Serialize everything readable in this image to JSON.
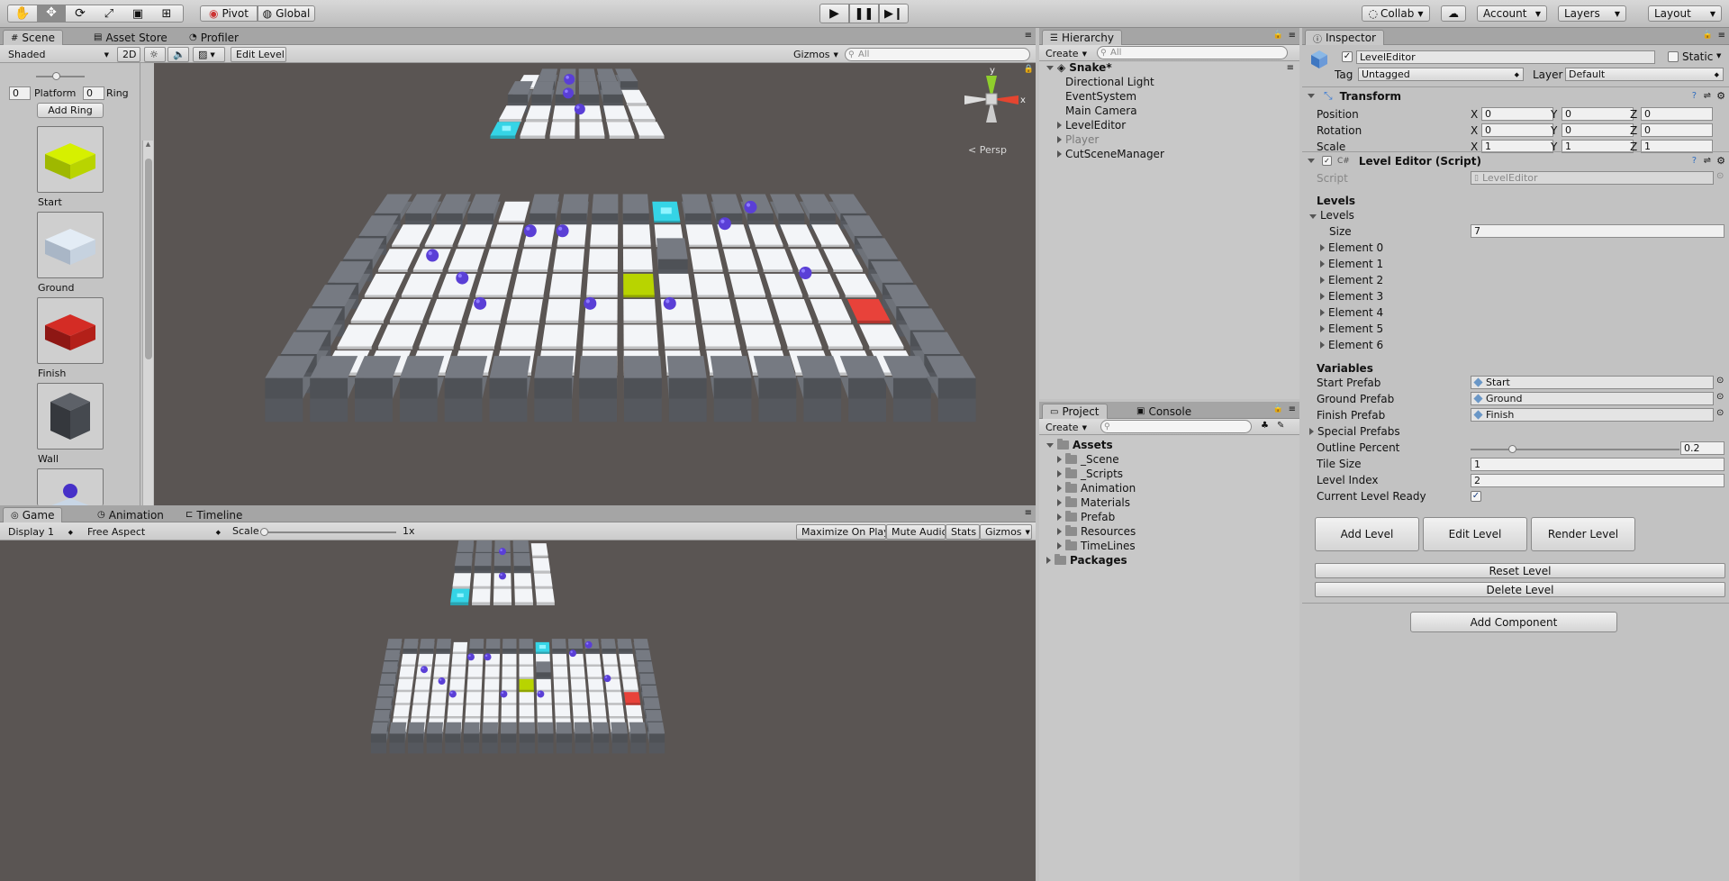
{
  "top_toolbar": {
    "pivot": "Pivot",
    "global": "Global",
    "collab": "Collab",
    "account": "Account",
    "layers": "Layers",
    "layout": "Layout"
  },
  "scene": {
    "tabs": [
      "Scene",
      "Asset Store",
      "Profiler"
    ],
    "shading": "Shaded",
    "mode_2d": "2D",
    "edit_level": "Edit Level",
    "gizmos": "Gizmos",
    "search_placeholder": "All",
    "persp": "Persp",
    "gizmo_y": "y",
    "gizmo_x": "x"
  },
  "level_palette": {
    "platform_value": "0",
    "platform_label": "Platform",
    "ring_value": "0",
    "ring_label": "Ring",
    "add_ring": "Add Ring",
    "items": [
      "Start",
      "Ground",
      "Finish",
      "Wall"
    ]
  },
  "game": {
    "tabs": [
      "Game",
      "Animation",
      "Timeline"
    ],
    "display": "Display 1",
    "aspect": "Free Aspect",
    "scale_label": "Scale",
    "scale_value": "1x",
    "maximize": "Maximize On Play",
    "mute": "Mute Audio",
    "stats": "Stats",
    "gizmos": "Gizmos"
  },
  "hierarchy": {
    "tab": "Hierarchy",
    "create": "Create",
    "search_placeholder": "All",
    "scene_name": "Snake*",
    "items": [
      {
        "label": "Directional Light",
        "expandable": false,
        "inactive": false
      },
      {
        "label": "EventSystem",
        "expandable": false,
        "inactive": false
      },
      {
        "label": "Main Camera",
        "expandable": false,
        "inactive": false
      },
      {
        "label": "LevelEditor",
        "expandable": true,
        "inactive": false
      },
      {
        "label": "Player",
        "expandable": true,
        "inactive": true
      },
      {
        "label": "CutSceneManager",
        "expandable": true,
        "inactive": false
      }
    ]
  },
  "project": {
    "tabs": [
      "Project",
      "Console"
    ],
    "create": "Create",
    "assets_label": "Assets",
    "folders": [
      "_Scene",
      "_Scripts",
      "Animation",
      "Materials",
      "Prefab",
      "Resources",
      "TimeLines"
    ],
    "packages_label": "Packages"
  },
  "inspector": {
    "tab": "Inspector",
    "object_name": "LevelEditor",
    "static_label": "Static",
    "tag_label": "Tag",
    "tag_value": "Untagged",
    "layer_label": "Layer",
    "layer_value": "Default",
    "transform": {
      "title": "Transform",
      "rows": [
        {
          "label": "Position",
          "x": "0",
          "y": "0",
          "z": "0"
        },
        {
          "label": "Rotation",
          "x": "0",
          "y": "0",
          "z": "0"
        },
        {
          "label": "Scale",
          "x": "1",
          "y": "1",
          "z": "1"
        }
      ],
      "axis_x": "X",
      "axis_y": "Y",
      "axis_z": "Z"
    },
    "script_component": {
      "title": "Level Editor (Script)",
      "script_label": "Script",
      "script_value": "LevelEditor",
      "levels_header": "Levels",
      "levels_foldout": "Levels",
      "size_label": "Size",
      "size_value": "7",
      "elements": [
        "Element 0",
        "Element 1",
        "Element 2",
        "Element 3",
        "Element 4",
        "Element 5",
        "Element 6"
      ],
      "variables_header": "Variables",
      "start_prefab_label": "Start Prefab",
      "start_prefab_value": "Start",
      "ground_prefab_label": "Ground Prefab",
      "ground_prefab_value": "Ground",
      "finish_prefab_label": "Finish Prefab",
      "finish_prefab_value": "Finish",
      "special_prefabs_label": "Special Prefabs",
      "outline_percent_label": "Outline Percent",
      "outline_percent_value": "0.2",
      "tile_size_label": "Tile Size",
      "tile_size_value": "1",
      "level_index_label": "Level Index",
      "level_index_value": "2",
      "current_level_ready_label": "Current Level Ready",
      "current_level_ready": true,
      "add_level": "Add Level",
      "edit_level": "Edit Level",
      "render_level": "Render Level",
      "reset_level": "Reset Level",
      "delete_level": "Delete Level"
    },
    "add_component": "Add Component"
  },
  "colors": {
    "accent_start": "#b8d400",
    "finish_red": "#e8423a",
    "ring_purple": "#5a3fd6",
    "platform_cyan": "#35d4e6",
    "wall_grey": "#6d7178",
    "ground_white": "#f3f5f8",
    "viewport_bg": "#5a5553"
  }
}
